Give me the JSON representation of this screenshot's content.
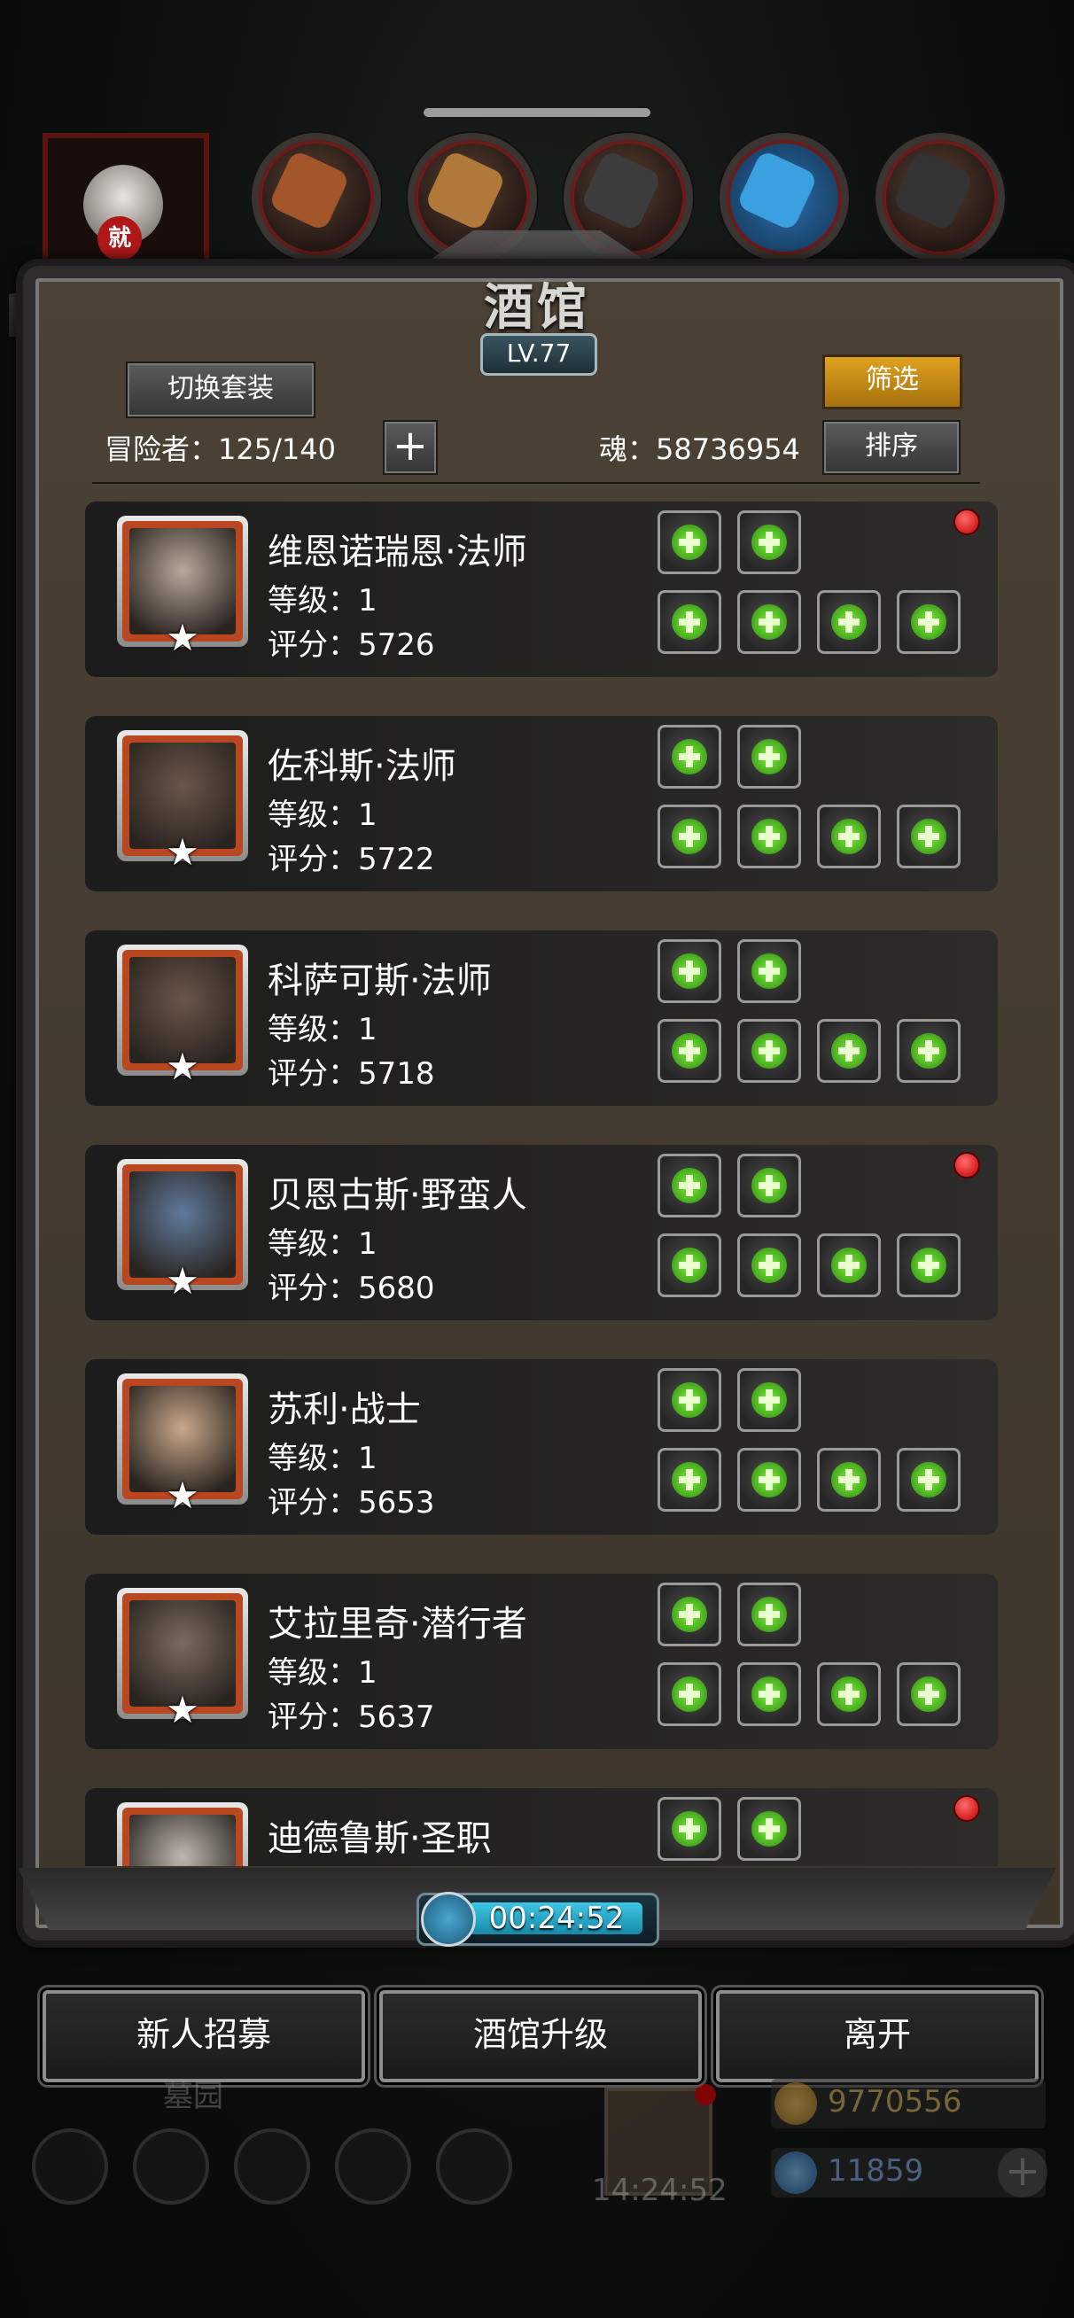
{
  "background": {
    "bottom_label": "墓园",
    "gift_timer": "14:24:52",
    "gold": "9770556",
    "gems": "11859",
    "top_avatar_tag": "就"
  },
  "header": {
    "title": "酒馆",
    "level": "LV.77",
    "switch_outfit_label": "切换套装",
    "filter_label": "筛选",
    "sort_label": "排序",
    "adventurer_label": "冒险者：",
    "adventurer_count": "125/140",
    "soul_label": "魂：",
    "soul_value": "58736954"
  },
  "heroes": [
    {
      "name": "维恩诺瑞恩·法师",
      "level": "等级：1",
      "score": "评分：5726",
      "alert": true,
      "face_color": "#b8a89a"
    },
    {
      "name": "佐科斯·法师",
      "level": "等级：1",
      "score": "评分：5722",
      "alert": false,
      "face_color": "#6b5548"
    },
    {
      "name": "科萨可斯·法师",
      "level": "等级：1",
      "score": "评分：5718",
      "alert": false,
      "face_color": "#6b5548"
    },
    {
      "name": "贝恩古斯·野蛮人",
      "level": "等级：1",
      "score": "评分：5680",
      "alert": true,
      "face_color": "#5f7a9c"
    },
    {
      "name": "苏利·战士",
      "level": "等级：1",
      "score": "评分：5653",
      "alert": false,
      "face_color": "#c9a88a"
    },
    {
      "name": "艾拉里奇·潜行者",
      "level": "等级：1",
      "score": "评分：5637",
      "alert": false,
      "face_color": "#7a6a5e"
    },
    {
      "name": "迪德鲁斯·圣职",
      "level": "",
      "score": "",
      "alert": true,
      "face_color": "#c0b8b0"
    }
  ],
  "timer": {
    "value": "00:24:52"
  },
  "actions": {
    "recruit": "新人招募",
    "upgrade": "酒馆升级",
    "leave": "离开"
  },
  "icons": {
    "star": "star-icon",
    "slot_add": "plus-icon",
    "clock": "clock-icon",
    "alert": "alert-dot-icon"
  }
}
